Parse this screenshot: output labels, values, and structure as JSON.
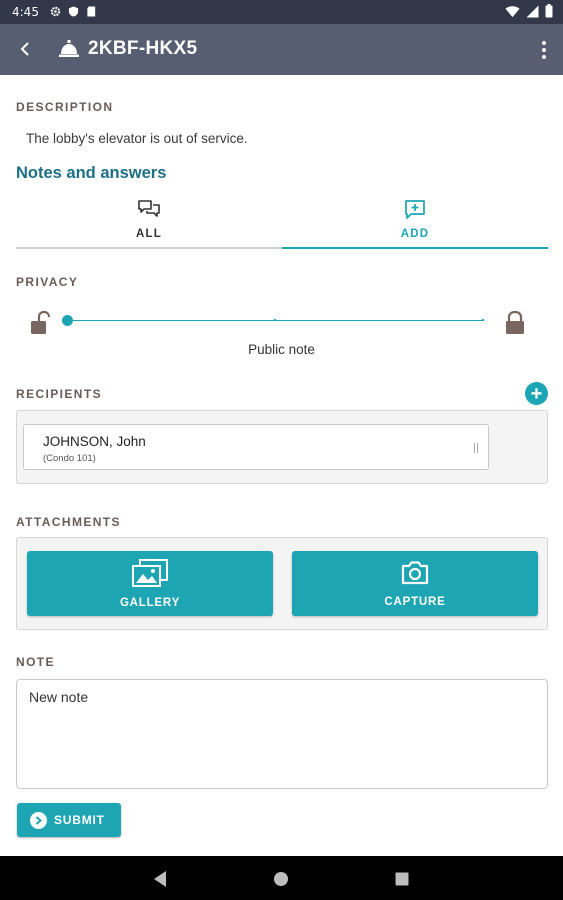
{
  "status_bar": {
    "time": "4:45",
    "icons": [
      "settings-icon",
      "shield-icon",
      "sd-card-icon",
      "wifi-icon",
      "signal-icon",
      "battery-icon"
    ]
  },
  "app_bar": {
    "title": "2KBF-HKX5",
    "icons": [
      "back-arrow-icon",
      "service-bell-icon",
      "overflow-menu-icon"
    ]
  },
  "description": {
    "label": "DESCRIPTION",
    "text": "The lobby's elevator is out of service."
  },
  "notes": {
    "title": "Notes and answers",
    "tabs": [
      {
        "label": "ALL",
        "icon": "chat-bubbles-icon",
        "selected": false
      },
      {
        "label": "ADD",
        "icon": "add-comment-icon",
        "selected": true
      }
    ]
  },
  "privacy": {
    "label": "PRIVACY",
    "caption": "Public note",
    "level": 0,
    "icons": [
      "lock-open-icon",
      "lock-closed-icon"
    ]
  },
  "recipients": {
    "label": "RECIPIENTS",
    "add_icon": "plus-circle-icon",
    "items": [
      {
        "name": "JOHNSON, John",
        "unit": "(Condo 101)"
      }
    ]
  },
  "attachments": {
    "label": "ATTACHMENTS",
    "gallery_label": "GALLERY",
    "capture_label": "CAPTURE",
    "icons": [
      "gallery-icon",
      "camera-icon"
    ]
  },
  "note": {
    "label": "NOTE",
    "placeholder": "New note"
  },
  "submit": {
    "label": "SUBMIT",
    "icon": "arrow-circle-icon"
  },
  "nav_bar": {
    "icons": [
      "nav-back-icon",
      "nav-home-icon",
      "nav-recents-icon"
    ]
  },
  "colors": {
    "accent": "#1ea5b3",
    "app_bar": "#575e72",
    "status_bar": "#32374a",
    "section_label": "#6b5b58",
    "notes_title": "#1c6f86"
  }
}
